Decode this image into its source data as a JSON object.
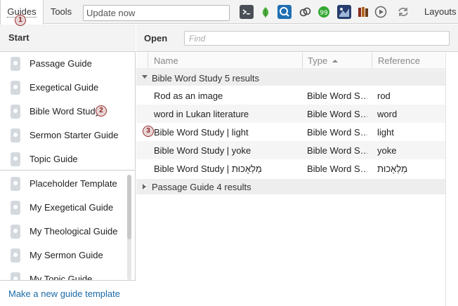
{
  "toolbar": {
    "tabs": [
      {
        "label": "Guides"
      },
      {
        "label": "Tools"
      }
    ],
    "update_value": "Update now",
    "layouts_label": "Layouts",
    "icons": [
      "command-icon",
      "leaf-icon",
      "search-magnifier-icon",
      "link-chain-icon",
      "chat-bubble-icon",
      "atlas-image-icon",
      "library-books-icon",
      "media-player-icon",
      "sync-icon"
    ]
  },
  "left": {
    "header": "Start",
    "guides": [
      {
        "label": "Passage Guide"
      },
      {
        "label": "Exegetical Guide"
      },
      {
        "label": "Bible Word Study"
      },
      {
        "label": "Sermon Starter Guide"
      },
      {
        "label": "Topic Guide"
      }
    ],
    "templates": [
      {
        "label": "Placeholder Template"
      },
      {
        "label": "My Exegetical Guide"
      },
      {
        "label": "My Theological Guide"
      },
      {
        "label": "My Sermon Guide"
      },
      {
        "label": "My Topic Guide"
      }
    ],
    "make_link": "Make a new guide template"
  },
  "right": {
    "open_label": "Open",
    "find_placeholder": "Find",
    "columns": [
      "Name",
      "Type",
      "Reference"
    ],
    "groups": [
      {
        "title": "Bible Word Study",
        "count": "5 results",
        "expanded": true
      },
      {
        "title": "Passage Guide",
        "count": "4 results",
        "expanded": false
      }
    ],
    "rows": [
      {
        "name": "Rod as an image",
        "type": "Bible Word S…",
        "reference": "rod"
      },
      {
        "name": "word in Lukan literature",
        "type": "Bible Word S…",
        "reference": "word"
      },
      {
        "name": "Bible Word Study | light",
        "type": "Bible Word S…",
        "reference": "light"
      },
      {
        "name": "Bible Word Study | yoke",
        "type": "Bible Word S…",
        "reference": "yoke"
      },
      {
        "name": "Bible Word Study | מַלְאָכוּת",
        "type": "Bible Word S…",
        "reference": "מַלְאָכוּת"
      }
    ]
  },
  "callouts": [
    "1",
    "2",
    "3"
  ],
  "colors": {
    "accent_link": "#1a6aa8",
    "callout_border": "#9b2f2f",
    "toolbar_bg": "#f3f3f3"
  }
}
